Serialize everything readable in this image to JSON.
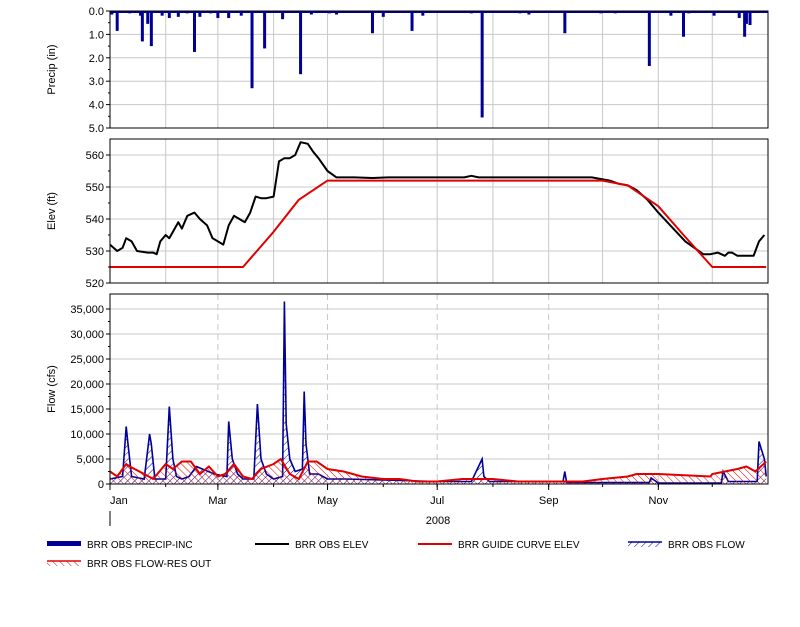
{
  "chart_data": [
    {
      "type": "bar",
      "ylabel": "Precip (in)",
      "ylim": [
        0,
        5
      ],
      "y_inverted": true,
      "yticks": [
        "0.0",
        "1.0",
        "2.0",
        "3.0",
        "4.0",
        "5.0"
      ],
      "grid": true,
      "series": [
        {
          "name": "BRR OBS PRECIP-INC",
          "color": "#000099",
          "x": [
            "2008-01-02",
            "2008-01-05",
            "2008-01-12",
            "2008-01-18",
            "2008-01-19",
            "2008-01-22",
            "2008-01-24",
            "2008-01-30",
            "2008-02-03",
            "2008-02-08",
            "2008-02-13",
            "2008-02-17",
            "2008-02-20",
            "2008-02-26",
            "2008-03-01",
            "2008-03-07",
            "2008-03-14",
            "2008-03-20",
            "2008-03-27",
            "2008-04-06",
            "2008-04-16",
            "2008-04-22",
            "2008-05-02",
            "2008-05-06",
            "2008-05-26",
            "2008-06-01",
            "2008-06-17",
            "2008-06-23",
            "2008-07-20",
            "2008-07-26",
            "2008-08-16",
            "2008-08-21",
            "2008-09-10",
            "2008-09-30",
            "2008-10-08",
            "2008-10-27",
            "2008-11-08",
            "2008-11-15",
            "2008-11-18",
            "2008-12-02",
            "2008-12-16",
            "2008-12-19",
            "2008-12-20",
            "2008-12-22"
          ],
          "values": [
            0.15,
            0.85,
            0.1,
            0.2,
            1.3,
            0.55,
            1.5,
            0.2,
            0.3,
            0.25,
            0.1,
            1.75,
            0.25,
            0.1,
            0.3,
            0.3,
            0.2,
            3.3,
            1.6,
            0.35,
            2.7,
            0.15,
            0.1,
            0.15,
            0.95,
            0.25,
            0.85,
            0.2,
            0.1,
            4.55,
            0.1,
            0.15,
            0.95,
            0.1,
            0.1,
            2.35,
            0.2,
            1.1,
            0.1,
            0.2,
            0.3,
            1.1,
            0.55,
            0.6
          ]
        }
      ]
    },
    {
      "type": "line",
      "ylabel": "Elev (ft)",
      "ylim": [
        520,
        565
      ],
      "yticks": [
        "520",
        "530",
        "540",
        "550",
        "560"
      ],
      "grid": true,
      "series": [
        {
          "name": "BRR OBS ELEV",
          "color": "#000000",
          "x": [
            "2008-01-01",
            "2008-01-05",
            "2008-01-08",
            "2008-01-10",
            "2008-01-13",
            "2008-01-16",
            "2008-01-22",
            "2008-01-25",
            "2008-01-27",
            "2008-01-29",
            "2008-02-01",
            "2008-02-03",
            "2008-02-06",
            "2008-02-08",
            "2008-02-10",
            "2008-02-13",
            "2008-02-17",
            "2008-02-20",
            "2008-02-24",
            "2008-02-27",
            "2008-03-01",
            "2008-03-04",
            "2008-03-07",
            "2008-03-10",
            "2008-03-13",
            "2008-03-16",
            "2008-03-19",
            "2008-03-22",
            "2008-03-25",
            "2008-03-28",
            "2008-04-01",
            "2008-04-04",
            "2008-04-07",
            "2008-04-10",
            "2008-04-13",
            "2008-04-16",
            "2008-04-20",
            "2008-04-23",
            "2008-04-26",
            "2008-05-01",
            "2008-05-06",
            "2008-05-11",
            "2008-05-16",
            "2008-05-26",
            "2008-06-04",
            "2008-06-17",
            "2008-06-27",
            "2008-07-06",
            "2008-07-16",
            "2008-07-20",
            "2008-07-24",
            "2008-07-29",
            "2008-08-05",
            "2008-08-16",
            "2008-08-26",
            "2008-09-05",
            "2008-09-15",
            "2008-09-25",
            "2008-09-30",
            "2008-10-05",
            "2008-10-10",
            "2008-10-15",
            "2008-10-20",
            "2008-10-26",
            "2008-11-01",
            "2008-11-06",
            "2008-11-11",
            "2008-11-16",
            "2008-11-21",
            "2008-11-26",
            "2008-11-30",
            "2008-12-04",
            "2008-12-08",
            "2008-12-10",
            "2008-12-12",
            "2008-12-15",
            "2008-12-20",
            "2008-12-24",
            "2008-12-27",
            "2008-12-30"
          ],
          "values": [
            532,
            530,
            531,
            534,
            533,
            530,
            529.5,
            529.5,
            529,
            533,
            535,
            534,
            537,
            539,
            537,
            541,
            542,
            540,
            538,
            534,
            533,
            532,
            538,
            541,
            540,
            539,
            542,
            547,
            546.5,
            546.5,
            547,
            558,
            559,
            559,
            560,
            564,
            563.5,
            561,
            559,
            555,
            553,
            553,
            553,
            552.8,
            553,
            553,
            553,
            553,
            553,
            553.5,
            553,
            553,
            553,
            553,
            553,
            553,
            553,
            553,
            552.5,
            552,
            551,
            550.5,
            549,
            546,
            542,
            539,
            536,
            533,
            531,
            529,
            529,
            529.5,
            528.5,
            529.5,
            529.5,
            528.5,
            528.5,
            528.5,
            533,
            535
          ]
        },
        {
          "name": "BRR GUIDE CURVE ELEV",
          "color": "#e00000",
          "x": [
            "2008-01-01",
            "2008-03-15",
            "2008-04-01",
            "2008-04-15",
            "2008-05-01",
            "2008-10-01",
            "2008-10-15",
            "2008-11-01",
            "2008-11-15",
            "2008-12-01",
            "2008-12-31"
          ],
          "values": [
            525,
            525,
            536,
            546,
            552,
            552,
            550.5,
            544,
            535,
            525,
            525
          ]
        }
      ]
    },
    {
      "type": "area",
      "ylabel": "Flow (cfs)",
      "ylim": [
        0,
        38000
      ],
      "yticks": [
        "0",
        "5,000",
        "10,000",
        "15,000",
        "20,000",
        "25,000",
        "30,000",
        "35,000"
      ],
      "xticks": [
        "Jan",
        "Mar",
        "May",
        "Jul",
        "Sep",
        "Nov"
      ],
      "xlabel": "2008",
      "grid": true,
      "series": [
        {
          "name": "BRR OBS FLOW",
          "color": "#000099",
          "x": [
            "2008-01-01",
            "2008-01-08",
            "2008-01-10",
            "2008-01-11",
            "2008-01-13",
            "2008-01-20",
            "2008-01-23",
            "2008-01-24",
            "2008-01-26",
            "2008-02-01",
            "2008-02-03",
            "2008-02-05",
            "2008-02-07",
            "2008-02-10",
            "2008-02-14",
            "2008-02-18",
            "2008-02-28",
            "2008-03-06",
            "2008-03-07",
            "2008-03-09",
            "2008-03-12",
            "2008-03-15",
            "2008-03-21",
            "2008-03-23",
            "2008-03-25",
            "2008-03-28",
            "2008-04-01",
            "2008-04-06",
            "2008-04-07",
            "2008-04-08",
            "2008-04-10",
            "2008-04-13",
            "2008-04-17",
            "2008-04-18",
            "2008-04-19",
            "2008-04-21",
            "2008-04-26",
            "2008-05-01",
            "2008-05-11",
            "2008-06-01",
            "2008-07-01",
            "2008-07-20",
            "2008-07-26",
            "2008-07-27",
            "2008-07-30",
            "2008-08-15",
            "2008-09-09",
            "2008-09-10",
            "2008-09-11",
            "2008-10-01",
            "2008-10-27",
            "2008-10-28",
            "2008-11-01",
            "2008-12-01",
            "2008-12-06",
            "2008-12-07",
            "2008-12-10",
            "2008-12-26",
            "2008-12-27",
            "2008-12-30",
            "2008-12-31"
          ],
          "values": [
            1000,
            1500,
            11500,
            8000,
            1500,
            1000,
            10000,
            8000,
            1000,
            1000,
            15500,
            5000,
            1500,
            1000,
            1500,
            3500,
            2000,
            1500,
            12500,
            5000,
            2000,
            1000,
            1000,
            16000,
            5000,
            2000,
            1000,
            1500,
            36500,
            12000,
            5000,
            2500,
            3000,
            18500,
            8000,
            2000,
            2000,
            1000,
            1000,
            800,
            500,
            500,
            5000,
            1500,
            500,
            500,
            500,
            2500,
            300,
            300,
            300,
            1200,
            200,
            200,
            200,
            2500,
            500,
            500,
            8500,
            5000,
            1500
          ]
        },
        {
          "name": "BRR OBS FLOW-RES OUT",
          "color": "#e00000",
          "x": [
            "2008-01-01",
            "2008-01-05",
            "2008-01-10",
            "2008-01-12",
            "2008-01-20",
            "2008-01-25",
            "2008-02-01",
            "2008-02-05",
            "2008-02-10",
            "2008-02-15",
            "2008-02-20",
            "2008-02-25",
            "2008-03-01",
            "2008-03-05",
            "2008-03-10",
            "2008-03-15",
            "2008-03-20",
            "2008-03-25",
            "2008-04-01",
            "2008-04-05",
            "2008-04-10",
            "2008-04-15",
            "2008-04-20",
            "2008-04-25",
            "2008-05-01",
            "2008-05-10",
            "2008-05-20",
            "2008-06-01",
            "2008-06-10",
            "2008-06-20",
            "2008-07-01",
            "2008-07-15",
            "2008-08-01",
            "2008-08-15",
            "2008-09-01",
            "2008-09-20",
            "2008-10-01",
            "2008-10-15",
            "2008-10-20",
            "2008-11-01",
            "2008-11-30",
            "2008-12-01",
            "2008-12-15",
            "2008-12-20",
            "2008-12-25",
            "2008-12-31"
          ],
          "values": [
            2500,
            1500,
            4000,
            3500,
            2000,
            1000,
            4000,
            3000,
            4500,
            4500,
            2000,
            3500,
            1500,
            2000,
            4000,
            1500,
            1000,
            3000,
            4000,
            5000,
            2000,
            1000,
            4500,
            4500,
            3000,
            2500,
            1500,
            1000,
            1000,
            500,
            500,
            1000,
            1000,
            500,
            500,
            500,
            1000,
            1500,
            2000,
            2000,
            1500,
            2000,
            3000,
            3500,
            2500,
            4500
          ]
        }
      ]
    }
  ],
  "legend": [
    {
      "name": "BRR OBS PRECIP-INC",
      "style": "thick-bar",
      "color": "#000099"
    },
    {
      "name": "BRR OBS ELEV",
      "style": "line",
      "color": "#000000"
    },
    {
      "name": "BRR GUIDE CURVE ELEV",
      "style": "line",
      "color": "#e00000"
    },
    {
      "name": "BRR OBS FLOW",
      "style": "hatched",
      "color": "#000099"
    },
    {
      "name": "BRR OBS FLOW-RES OUT",
      "style": "hatched",
      "color": "#e00000"
    }
  ]
}
